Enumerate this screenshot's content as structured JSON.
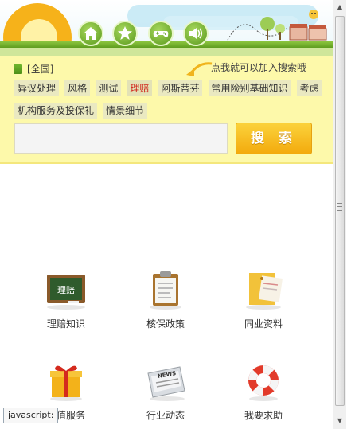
{
  "header": {
    "tabs": [
      {
        "icon": "home-icon"
      },
      {
        "icon": "star-icon"
      },
      {
        "icon": "gamepad-icon"
      },
      {
        "icon": "speaker-icon"
      }
    ]
  },
  "search": {
    "scope": "[全国]",
    "hint": "点我就可以加入搜索哦",
    "tags": [
      "异议处理",
      "风格",
      "测试",
      "理赔",
      "阿斯蒂芬",
      "常用险别基础知识",
      "考虑",
      "机构服务及投保礼",
      "情景细节"
    ],
    "active_tag": "理赔",
    "input_value": "",
    "button_label": "搜 索",
    "colors": {
      "button": "#f7be22",
      "panel": "#fdf9aa",
      "active_tag": "#d0241b"
    }
  },
  "grid": {
    "items": [
      {
        "label": "理赔知识",
        "icon": "blackboard-icon",
        "board_text": "理赔"
      },
      {
        "label": "核保政策",
        "icon": "clipboard-icon"
      },
      {
        "label": "同业资料",
        "icon": "folder-icon"
      },
      {
        "label": "增值服务",
        "icon": "gift-icon"
      },
      {
        "label": "行业动态",
        "icon": "newspaper-icon",
        "paper_text": "NEWS"
      },
      {
        "label": "我要求助",
        "icon": "lifebuoy-icon"
      }
    ]
  },
  "status_bar": {
    "text": "javascript:"
  }
}
